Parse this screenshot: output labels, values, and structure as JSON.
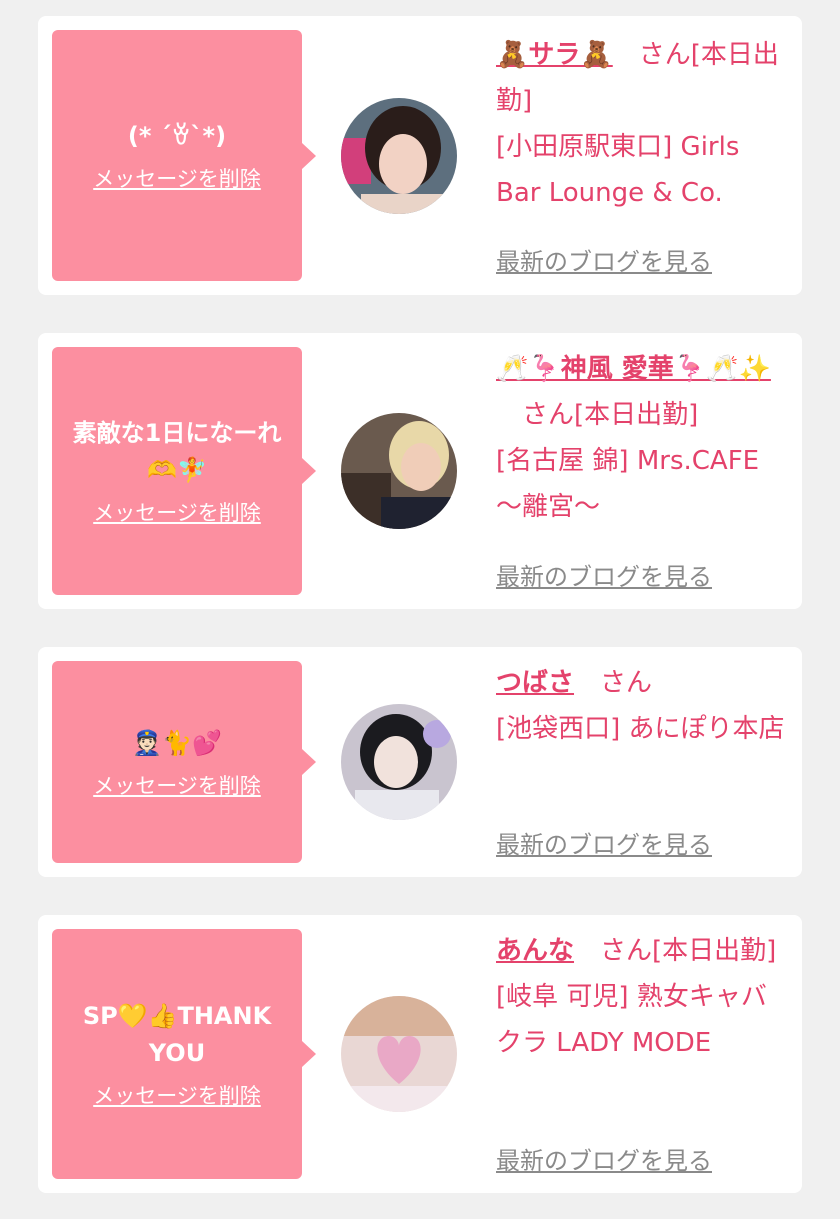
{
  "delete_label": "メッセージを削除",
  "blog_label": "最新のブログを見る",
  "colors": {
    "bubble": "#fc8fa0",
    "accent": "#e4426b",
    "link_gray": "#8a8a8a",
    "background": "#f0f0f0"
  },
  "cards": [
    {
      "message": "(* ´ꈊ`*)",
      "name": "🧸サラ🧸",
      "san_suffix": "さん[本日出勤]",
      "shop": "[小田原駅東口] Girls Bar Lounge & Co."
    },
    {
      "message": "素敵な1日になーれ🫶🧚",
      "name": "🥂🦩神風 愛華🦩🥂✨",
      "san_suffix": "さん[本日出勤]",
      "shop": "[名古屋 錦] Mrs.CAFE 〜離宮〜"
    },
    {
      "message": "👮🏻🐈💕",
      "name": "つばさ",
      "san_suffix": "さん",
      "shop": "[池袋西口] あにぽり本店"
    },
    {
      "message": "SP💛👍THANK YOU",
      "name": "あんな",
      "san_suffix": "さん[本日出勤]",
      "shop": "[岐阜 可児] 熟女キャバクラ LADY MODE"
    }
  ]
}
